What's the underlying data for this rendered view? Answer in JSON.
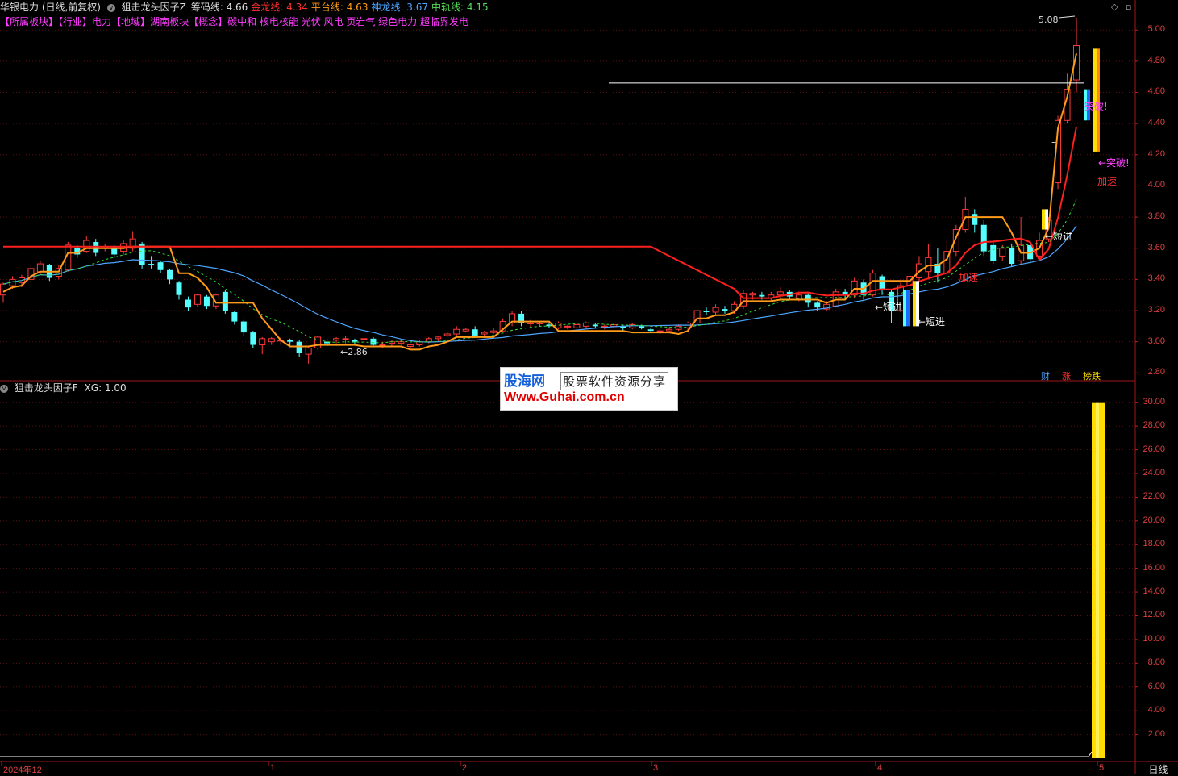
{
  "header": {
    "stock_title": "华银电力 (日线,前复权)",
    "indicator_name": "狙击龙头因子Z",
    "metrics": [
      {
        "label": "筹码线:",
        "value": "4.66",
        "color": "#dddddd"
      },
      {
        "label": "金龙线:",
        "value": "4.34",
        "color": "#ff3030"
      },
      {
        "label": "平台线:",
        "value": "4.63",
        "color": "#ff9a1a"
      },
      {
        "label": "神龙线:",
        "value": "3.67",
        "color": "#4da6ff"
      },
      {
        "label": "中轨线:",
        "value": "4.15",
        "color": "#55dd55"
      }
    ]
  },
  "sector_tags": [
    {
      "text": "【所属板块】",
      "kind": "tag"
    },
    {
      "text": "【行业】",
      "kind": "tag"
    },
    {
      "text": "电力",
      "kind": "cat"
    },
    {
      "text": "【地域】",
      "kind": "tag"
    },
    {
      "text": "湖南板块",
      "kind": "cat"
    },
    {
      "text": "【概念】",
      "kind": "tag"
    },
    {
      "text": "碳中和 核电核能 光伏 风电 页岩气 绿色电力 超临界发电",
      "kind": "cat"
    }
  ],
  "lower_panel": {
    "indicator_name": "狙击龙头因子F",
    "xg_label": "XG: 1.00",
    "y_ticks": [
      "30.00",
      "28.00",
      "26.00",
      "24.00",
      "22.00",
      "20.00",
      "18.00",
      "16.00",
      "14.00",
      "12.00",
      "10.00",
      "8.00",
      "6.00",
      "4.00",
      "2.00"
    ]
  },
  "upper_panel": {
    "y_ticks": [
      "5.00",
      "4.80",
      "4.60",
      "4.40",
      "4.20",
      "4.00",
      "3.80",
      "3.60",
      "3.40",
      "3.20",
      "3.00",
      "2.80"
    ],
    "annotations": {
      "high": "5.08",
      "low": "←2.86",
      "short_entry": "短进",
      "short_entry_left": "←短进",
      "short_entry_arrow": "←短进",
      "breakout": "突破!",
      "breakout_arrow": "←突破!",
      "accelerate": "加速",
      "dash": "–"
    },
    "badges": [
      {
        "text": "财",
        "color": "#4da6ff"
      },
      {
        "text": "涨",
        "color": "#ff3030"
      },
      {
        "text": "榜跌",
        "color": "#ffdd00"
      }
    ]
  },
  "x_axis": {
    "labels": [
      "2024年12",
      "1",
      "2",
      "3",
      "4",
      "5"
    ],
    "period_button": "日线"
  },
  "watermark": {
    "brand": "股海网",
    "subtitle": "股票软件资源分享",
    "url": "Www.Guhai.com.cn"
  },
  "colors": {
    "up": "#ff3a3a",
    "down": "#54ffff",
    "cost_line": "#ff2020",
    "platform_line": "#ff9a1a",
    "god_line": "#4da6ff",
    "mid_line": "#33dd33",
    "xg_bar": "#ffdd00"
  },
  "chart_data": {
    "type": "candlestick",
    "y_range": [
      2.75,
      5.12
    ],
    "candles": [
      [
        3.3,
        3.37,
        3.25,
        3.38
      ],
      [
        3.36,
        3.4,
        3.34,
        3.42
      ],
      [
        3.38,
        3.41,
        3.35,
        3.43
      ],
      [
        3.4,
        3.47,
        3.38,
        3.49
      ],
      [
        3.45,
        3.5,
        3.43,
        3.52
      ],
      [
        3.49,
        3.41,
        3.39,
        3.5
      ],
      [
        3.42,
        3.47,
        3.4,
        3.49
      ],
      [
        3.46,
        3.62,
        3.45,
        3.64
      ],
      [
        3.6,
        3.56,
        3.54,
        3.62
      ],
      [
        3.58,
        3.65,
        3.57,
        3.68
      ],
      [
        3.64,
        3.57,
        3.55,
        3.66
      ],
      [
        3.6,
        3.61,
        3.58,
        3.63
      ],
      [
        3.6,
        3.56,
        3.54,
        3.62
      ],
      [
        3.58,
        3.63,
        3.56,
        3.65
      ],
      [
        3.6,
        3.66,
        3.58,
        3.71
      ],
      [
        3.63,
        3.49,
        3.47,
        3.64
      ],
      [
        3.5,
        3.49,
        3.47,
        3.55
      ],
      [
        3.51,
        3.46,
        3.44,
        3.52
      ],
      [
        3.46,
        3.4,
        3.37,
        3.47
      ],
      [
        3.38,
        3.3,
        3.27,
        3.39
      ],
      [
        3.27,
        3.22,
        3.2,
        3.29
      ],
      [
        3.24,
        3.3,
        3.22,
        3.31
      ],
      [
        3.29,
        3.23,
        3.21,
        3.3
      ],
      [
        3.23,
        3.3,
        3.21,
        3.31
      ],
      [
        3.32,
        3.2,
        3.18,
        3.33
      ],
      [
        3.19,
        3.13,
        3.11,
        3.2
      ],
      [
        3.13,
        3.06,
        3.04,
        3.14
      ],
      [
        3.06,
        2.98,
        2.96,
        3.07
      ],
      [
        2.98,
        3.02,
        2.92,
        3.03
      ],
      [
        3.0,
        3.02,
        2.98,
        3.03
      ],
      [
        3.01,
        3.01,
        2.98,
        3.03
      ],
      [
        3.01,
        3.0,
        2.97,
        3.02
      ],
      [
        3.0,
        2.93,
        2.9,
        3.01
      ],
      [
        2.92,
        2.96,
        2.86,
        2.97
      ],
      [
        2.96,
        3.03,
        2.95,
        3.04
      ],
      [
        3.0,
        2.99,
        2.97,
        3.02
      ],
      [
        3.01,
        3.02,
        2.99,
        3.03
      ],
      [
        3.02,
        3.02,
        2.99,
        3.04
      ],
      [
        3.01,
        3.0,
        2.98,
        3.02
      ],
      [
        3.02,
        3.02,
        2.99,
        3.04
      ],
      [
        3.02,
        2.98,
        2.97,
        3.03
      ],
      [
        2.98,
        2.98,
        2.96,
        3.0
      ],
      [
        2.99,
        3.0,
        2.97,
        3.01
      ],
      [
        2.99,
        3.0,
        2.98,
        3.01
      ],
      [
        2.97,
        2.98,
        2.95,
        2.99
      ],
      [
        2.98,
        3.0,
        2.97,
        3.01
      ],
      [
        3.0,
        3.02,
        2.99,
        3.03
      ],
      [
        3.02,
        3.03,
        3.0,
        3.04
      ],
      [
        3.04,
        3.05,
        3.03,
        3.06
      ],
      [
        3.05,
        3.08,
        3.03,
        3.1
      ],
      [
        3.07,
        3.08,
        3.06,
        3.09
      ],
      [
        3.08,
        3.04,
        3.03,
        3.1
      ],
      [
        3.05,
        3.06,
        3.03,
        3.07
      ],
      [
        3.06,
        3.07,
        3.05,
        3.09
      ],
      [
        3.07,
        3.13,
        3.06,
        3.15
      ],
      [
        3.12,
        3.18,
        3.1,
        3.2
      ],
      [
        3.18,
        3.12,
        3.1,
        3.2
      ],
      [
        3.12,
        3.12,
        3.09,
        3.14
      ],
      [
        3.12,
        3.12,
        3.1,
        3.13
      ],
      [
        3.11,
        3.1,
        3.09,
        3.12
      ],
      [
        3.09,
        3.12,
        3.08,
        3.13
      ],
      [
        3.1,
        3.1,
        3.08,
        3.11
      ],
      [
        3.09,
        3.11,
        3.08,
        3.12
      ],
      [
        3.1,
        3.12,
        3.08,
        3.13
      ],
      [
        3.11,
        3.1,
        3.09,
        3.12
      ],
      [
        3.1,
        3.1,
        3.08,
        3.11
      ],
      [
        3.1,
        3.11,
        3.09,
        3.12
      ],
      [
        3.1,
        3.09,
        3.07,
        3.11
      ],
      [
        3.09,
        3.11,
        3.08,
        3.12
      ],
      [
        3.1,
        3.09,
        3.08,
        3.11
      ],
      [
        3.08,
        3.07,
        3.06,
        3.09
      ],
      [
        3.07,
        3.07,
        3.05,
        3.08
      ],
      [
        3.07,
        3.08,
        3.06,
        3.09
      ],
      [
        3.08,
        3.1,
        3.07,
        3.11
      ],
      [
        3.09,
        3.12,
        3.07,
        3.13
      ],
      [
        3.12,
        3.2,
        3.1,
        3.23
      ],
      [
        3.2,
        3.19,
        3.17,
        3.22
      ],
      [
        3.19,
        3.22,
        3.17,
        3.24
      ],
      [
        3.21,
        3.2,
        3.18,
        3.23
      ],
      [
        3.2,
        3.24,
        3.18,
        3.26
      ],
      [
        3.23,
        3.31,
        3.21,
        3.33
      ],
      [
        3.3,
        3.31,
        3.27,
        3.32
      ],
      [
        3.3,
        3.29,
        3.27,
        3.32
      ],
      [
        3.28,
        3.3,
        3.26,
        3.32
      ],
      [
        3.3,
        3.32,
        3.27,
        3.35
      ],
      [
        3.32,
        3.29,
        3.27,
        3.33
      ],
      [
        3.28,
        3.3,
        3.26,
        3.32
      ],
      [
        3.3,
        3.25,
        3.22,
        3.31
      ],
      [
        3.25,
        3.22,
        3.2,
        3.26
      ],
      [
        3.21,
        3.24,
        3.2,
        3.26
      ],
      [
        3.23,
        3.32,
        3.22,
        3.34
      ],
      [
        3.32,
        3.3,
        3.27,
        3.34
      ],
      [
        3.3,
        3.39,
        3.28,
        3.41
      ],
      [
        3.38,
        3.3,
        3.27,
        3.4
      ],
      [
        3.3,
        3.44,
        3.29,
        3.46
      ],
      [
        3.42,
        3.33,
        3.3,
        3.43
      ],
      [
        3.32,
        3.2,
        3.12,
        3.33
      ],
      [
        3.2,
        3.36,
        3.19,
        3.38
      ],
      [
        3.36,
        3.42,
        3.3,
        3.44
      ],
      [
        3.41,
        3.5,
        3.38,
        3.55
      ],
      [
        3.45,
        3.54,
        3.4,
        3.63
      ],
      [
        3.5,
        3.44,
        3.38,
        3.6
      ],
      [
        3.44,
        3.58,
        3.42,
        3.65
      ],
      [
        3.58,
        3.72,
        3.55,
        3.75
      ],
      [
        3.72,
        3.85,
        3.7,
        3.93
      ],
      [
        3.82,
        3.75,
        3.7,
        3.85
      ],
      [
        3.75,
        3.58,
        3.55,
        3.78
      ],
      [
        3.62,
        3.52,
        3.5,
        3.65
      ],
      [
        3.55,
        3.6,
        3.52,
        3.62
      ],
      [
        3.6,
        3.5,
        3.48,
        3.63
      ],
      [
        3.52,
        3.62,
        3.5,
        3.8
      ],
      [
        3.62,
        3.53,
        3.5,
        3.65
      ],
      [
        3.55,
        3.65,
        3.52,
        3.7
      ],
      [
        3.66,
        3.78,
        3.64,
        3.8
      ],
      [
        4.02,
        4.42,
        3.98,
        4.45
      ],
      [
        4.42,
        4.62,
        4.4,
        4.72
      ],
      [
        4.68,
        4.9,
        4.6,
        5.08
      ]
    ]
  }
}
